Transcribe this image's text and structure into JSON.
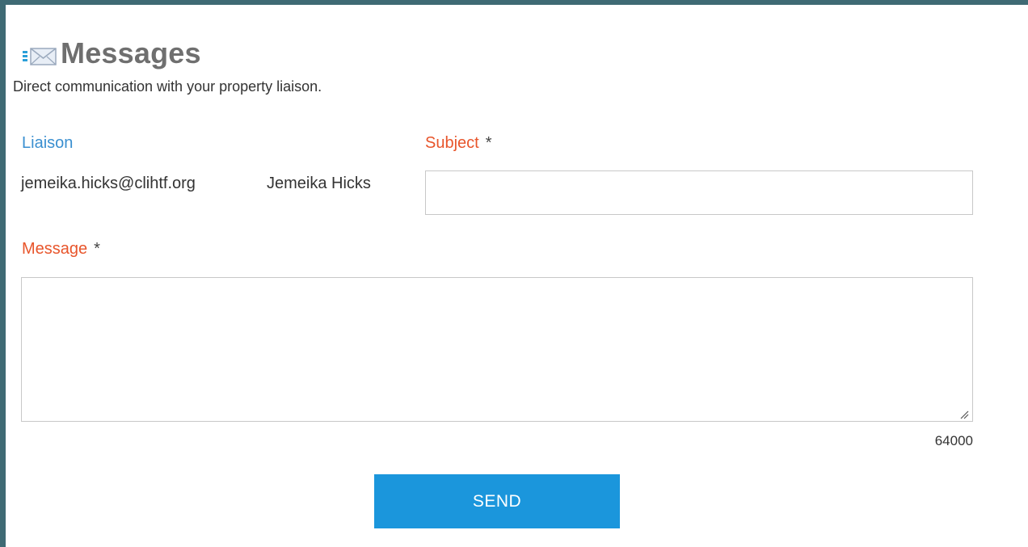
{
  "header": {
    "icon": "mail-envelope-icon",
    "title": "Messages",
    "subtitle": "Direct communication with your property liaison."
  },
  "liaison": {
    "label": "Liaison",
    "email": "jemeika.hicks@clihtf.org",
    "name": "Jemeika Hicks"
  },
  "subject": {
    "label": "Subject",
    "required_marker": "*",
    "value": "",
    "placeholder": ""
  },
  "message": {
    "label": "Message",
    "required_marker": "*",
    "value": "",
    "placeholder": "",
    "char_counter": "64000"
  },
  "actions": {
    "send_label": "SEND"
  },
  "colors": {
    "background_frame": "#3f6a74",
    "title": "#6f6f6f",
    "liaison_label": "#3a8fd0",
    "required_label": "#e8552b",
    "send_button": "#1b96dc"
  }
}
